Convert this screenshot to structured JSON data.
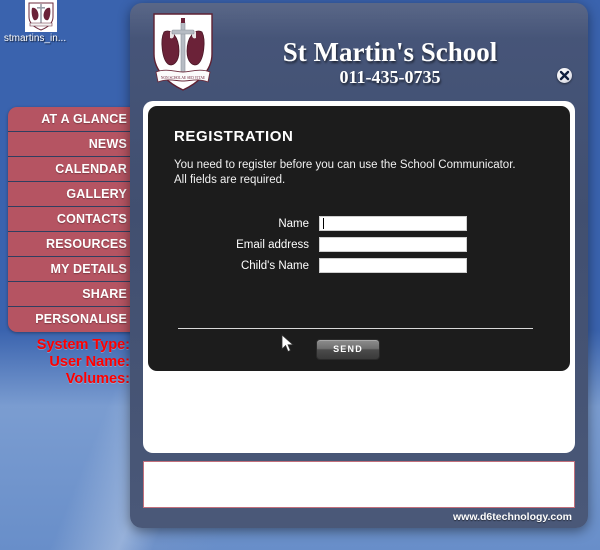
{
  "desktop": {
    "icon": {
      "name": "stmartins_in...",
      "icon_glyph": "school-crest-icon"
    },
    "system_info": [
      "System Type:",
      "User Name:",
      "Volumes:"
    ],
    "system_info_color": "#ff0000"
  },
  "sidebar": {
    "accent_color": "#b55462",
    "items": [
      {
        "label": "AT A GLANCE"
      },
      {
        "label": "NEWS"
      },
      {
        "label": "CALENDAR"
      },
      {
        "label": "GALLERY"
      },
      {
        "label": "CONTACTS"
      },
      {
        "label": "RESOURCES"
      },
      {
        "label": "MY DETAILS"
      },
      {
        "label": "SHARE"
      },
      {
        "label": "PERSONALISE"
      }
    ]
  },
  "app": {
    "header": {
      "title": "St Martin's School",
      "phone": "011-435-0735",
      "crest_alt": "school-crest",
      "close_label": "close"
    },
    "registration": {
      "heading": "REGISTRATION",
      "description_line1": "You need to register before you can use the School Communicator.",
      "description_line2": "All fields are required.",
      "fields": [
        {
          "label": "Name",
          "value": "",
          "placeholder": ""
        },
        {
          "label": "Email address",
          "value": "",
          "placeholder": ""
        },
        {
          "label": "Child's Name",
          "value": "",
          "placeholder": ""
        }
      ],
      "submit_label": "SEND"
    },
    "footer": {
      "url": "www.d6technology.com"
    }
  }
}
